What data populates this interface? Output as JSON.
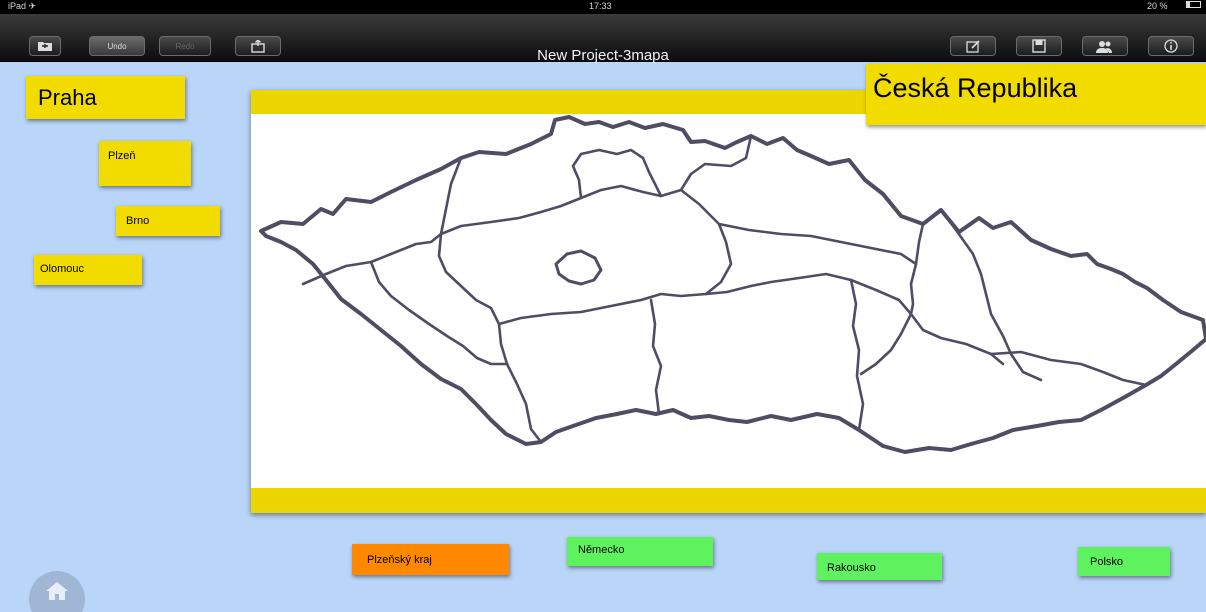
{
  "status_bar": {
    "device": "iPad ✈",
    "time": "17:33",
    "battery": "20 %",
    "battery_level": 0.2
  },
  "toolbar": {
    "undo_label": "Undo",
    "redo_label": "Redo",
    "title": "New Project-3mapa",
    "icons": [
      "folder-icon",
      "share-icon",
      "edit-icon",
      "save-icon",
      "users-icon",
      "info-icon"
    ]
  },
  "labels": {
    "praha": "Praha",
    "plzen": "Plzeň",
    "brno": "Brno",
    "olomouc": "Olomouc",
    "ceska_republika": "Česká Republika",
    "plzensky_kraj": "Plzeňský kraj",
    "nemecko": "Německo",
    "rakousko": "Rakousko",
    "polsko": "Polsko"
  },
  "colors": {
    "background": "#b9d5f7",
    "sticky_yellow": "#f2dc00",
    "sticky_green": "#5ef25e",
    "sticky_orange": "#ff8800",
    "map_outline": "#4f4c63"
  },
  "home_icon": "home-icon"
}
